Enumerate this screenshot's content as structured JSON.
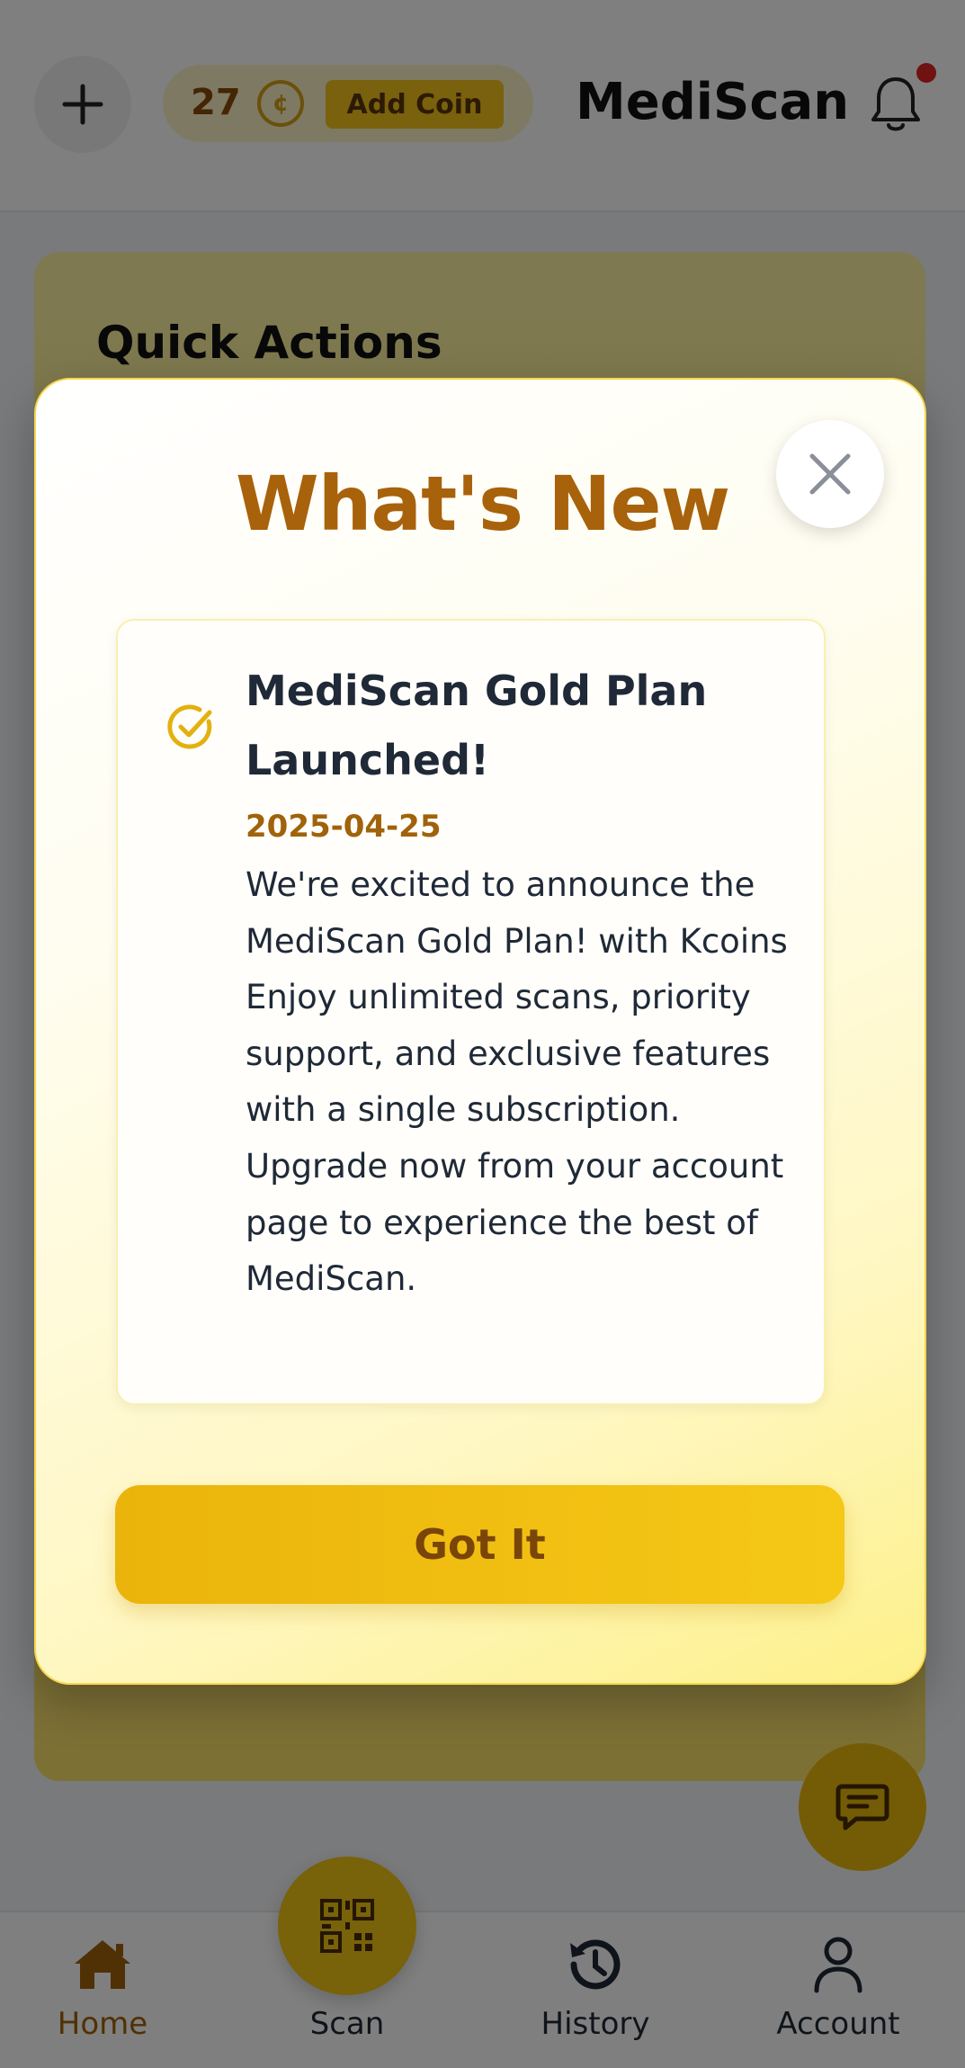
{
  "header": {
    "add_icon": "plus-icon",
    "coin_count": "27",
    "coin_icon_glyph": "¢",
    "add_coin_label": "Add Coin",
    "app_title": "MediScan",
    "notification_icon": "bell-icon",
    "has_unread": true
  },
  "main": {
    "quick_actions_title": "Quick Actions"
  },
  "modal": {
    "title": "What's New",
    "close_icon": "close-icon",
    "news": {
      "status_icon": "check-circle-icon",
      "title": "MediScan Gold Plan Launched!",
      "date": "2025-04-25",
      "body": "We're excited to announce the MediScan Gold Plan! with Kcoins Enjoy unlimited scans, priority support, and exclusive features with a single subscription. Upgrade now from your account page to experience the best of MediScan."
    },
    "confirm_label": "Got It"
  },
  "chat_fab_icon": "chat-icon",
  "bottom_nav": {
    "items": [
      {
        "label": "Home",
        "icon": "home-icon",
        "active": true
      },
      {
        "label": "Scan",
        "icon": "qr-scan-icon",
        "active": false
      },
      {
        "label": "History",
        "icon": "history-icon",
        "active": false
      },
      {
        "label": "Account",
        "icon": "account-icon",
        "active": false
      }
    ]
  },
  "colors": {
    "brand_gold": "#f2c21b",
    "brand_brown": "#a0620a",
    "notification_dot": "#e02424"
  }
}
